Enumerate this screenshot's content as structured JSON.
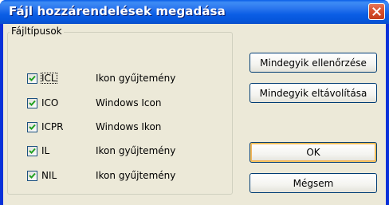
{
  "window": {
    "title": "Fájl hozzárendelések megadása"
  },
  "group": {
    "legend": "Fájltípusok"
  },
  "file_types": [
    {
      "ext": "ICL",
      "description": "Ikon gyűjtemény",
      "checked": true
    },
    {
      "ext": "ICO",
      "description": "Windows Icon",
      "checked": true
    },
    {
      "ext": "ICPR",
      "description": "Windows Ikon",
      "checked": true
    },
    {
      "ext": "IL",
      "description": "Ikon gyűjtemény",
      "checked": true
    },
    {
      "ext": "NIL",
      "description": "Ikon gyűjtemény",
      "checked": true
    }
  ],
  "buttons": {
    "check_all": "Mindegyik ellenőrzése",
    "remove_all": "Mindegyik eltávolítása",
    "ok": "OK",
    "cancel": "Mégsem"
  },
  "colors": {
    "titlebar": "#0a5ee8",
    "close_button": "#d9512d",
    "dialog_background": "#ece9d8",
    "checkmark": "#21a121",
    "default_button_highlight": "#f3b35a"
  },
  "icons": {
    "close": "close-x-icon",
    "check": "checkmark-icon"
  }
}
